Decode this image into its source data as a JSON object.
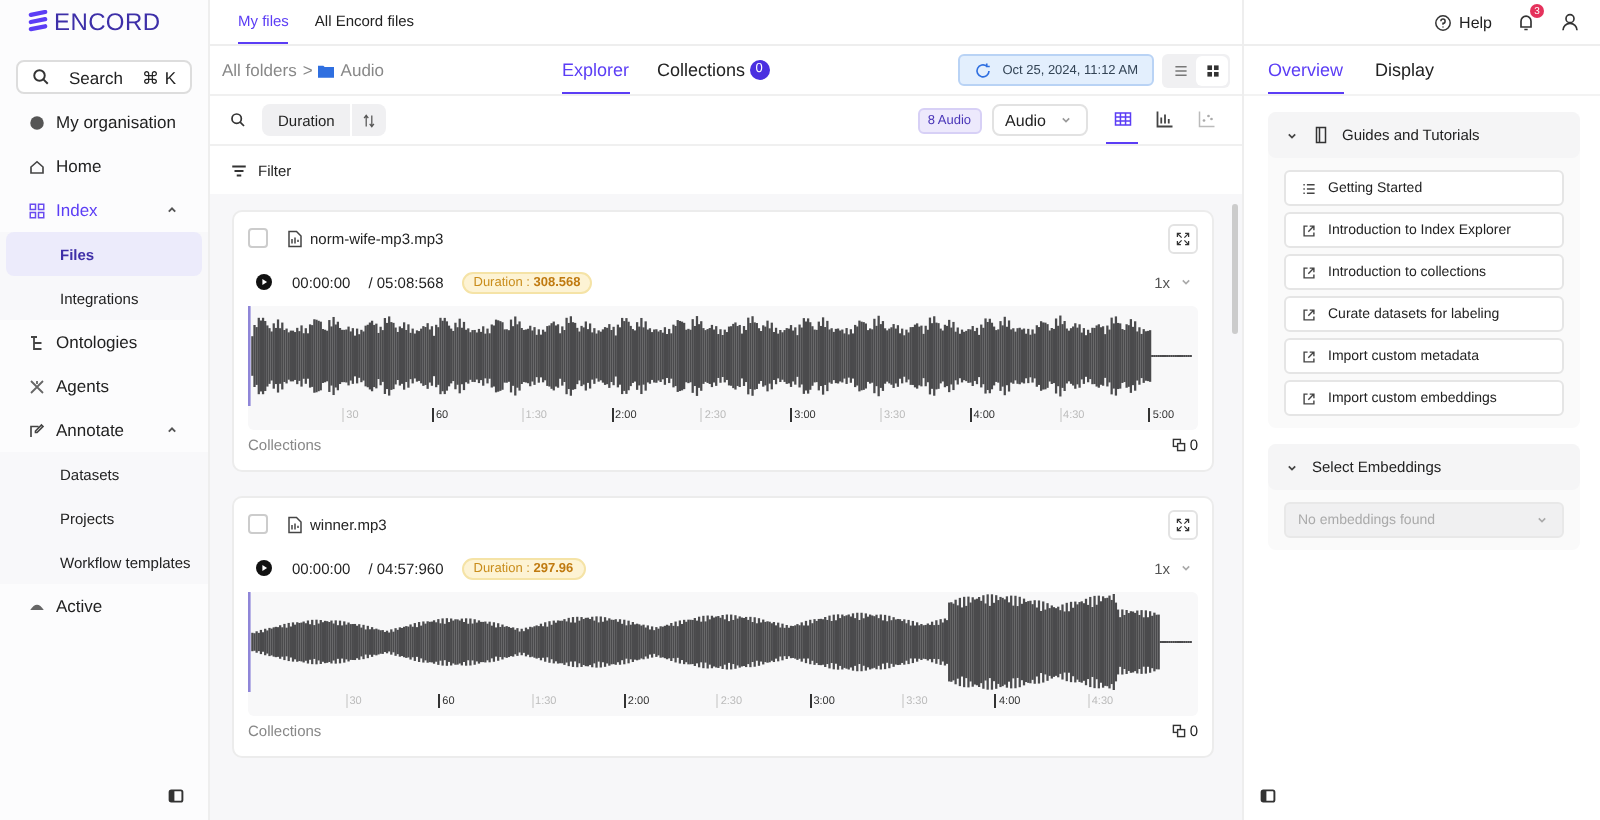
{
  "logo": {
    "text": "ENCORD"
  },
  "search": {
    "label": "Search",
    "shortcut": "⌘ K"
  },
  "sidebar": {
    "items": [
      {
        "label": "My organisation"
      },
      {
        "label": "Home"
      },
      {
        "label": "Index",
        "expanded": true,
        "selected": true,
        "children": [
          {
            "label": "Files",
            "selected": true
          },
          {
            "label": "Integrations",
            "selected": false
          }
        ]
      },
      {
        "label": "Ontologies"
      },
      {
        "label": "Agents"
      },
      {
        "label": "Annotate",
        "expanded": true,
        "selected": false,
        "children": [
          {
            "label": "Datasets",
            "selected": false
          },
          {
            "label": "Projects",
            "selected": false
          },
          {
            "label": "Workflow templates",
            "selected": false
          }
        ]
      },
      {
        "label": "Active"
      }
    ]
  },
  "top_tabs": [
    {
      "label": "My files",
      "selected": true
    },
    {
      "label": "All Encord files",
      "selected": false
    }
  ],
  "help": "Help",
  "notification_count": "3",
  "breadcrumb": {
    "root": "All folders",
    "separator": ">",
    "folder": "Audio"
  },
  "view_tabs": [
    {
      "label": "Explorer",
      "selected": true
    },
    {
      "label": "Collections",
      "selected": false,
      "count": "0"
    }
  ],
  "sync_time": "Oct 25, 2024, 11:12 AM",
  "layout_toggle": [
    {
      "kind": "list",
      "selected": false
    },
    {
      "kind": "gallery",
      "selected": true
    }
  ],
  "sort": {
    "label": "Duration"
  },
  "count_badge": "8 Audio",
  "type_select": "Audio",
  "view_modes": [
    {
      "kind": "grid",
      "selected": true
    },
    {
      "kind": "bar",
      "selected": false
    },
    {
      "kind": "scatter",
      "selected": false
    }
  ],
  "filter": "Filter",
  "files": [
    {
      "name": "norm-wife-mp3.mp3",
      "checked": false,
      "current": "00:00:00",
      "total": "/ 05:08:568",
      "duration_label": "Duration :",
      "duration": "308.568",
      "speed": "1x",
      "ticks": [
        "30",
        "60",
        "1:30",
        "2:00",
        "2:30",
        "3:00",
        "3:30",
        "4:00",
        "4:30",
        "5:00"
      ],
      "collections_label": "Collections",
      "collections_count": "0"
    },
    {
      "name": "winner.mp3",
      "checked": false,
      "current": "00:00:00",
      "total": "/ 04:57:960",
      "duration_label": "Duration :",
      "duration": "297.96",
      "speed": "1x",
      "ticks": [
        "30",
        "60",
        "1:30",
        "2:00",
        "2:30",
        "3:00",
        "3:30",
        "4:00",
        "4:30"
      ],
      "collections_label": "Collections",
      "collections_count": "0"
    }
  ],
  "right_tabs": [
    {
      "label": "Overview",
      "selected": true
    },
    {
      "label": "Display",
      "selected": false
    }
  ],
  "guides": {
    "title": "Guides and Tutorials",
    "expanded": true,
    "links": [
      {
        "label": "Getting Started",
        "kind": "list"
      },
      {
        "label": "Introduction to Index Explorer",
        "kind": "external"
      },
      {
        "label": "Introduction to collections",
        "kind": "external"
      },
      {
        "label": "Curate datasets for labeling",
        "kind": "external"
      },
      {
        "label": "Import custom metadata",
        "kind": "external"
      },
      {
        "label": "Import custom embeddings",
        "kind": "external"
      }
    ]
  },
  "embeddings": {
    "title": "Select Embeddings",
    "expanded": true,
    "placeholder": "No embeddings found"
  }
}
